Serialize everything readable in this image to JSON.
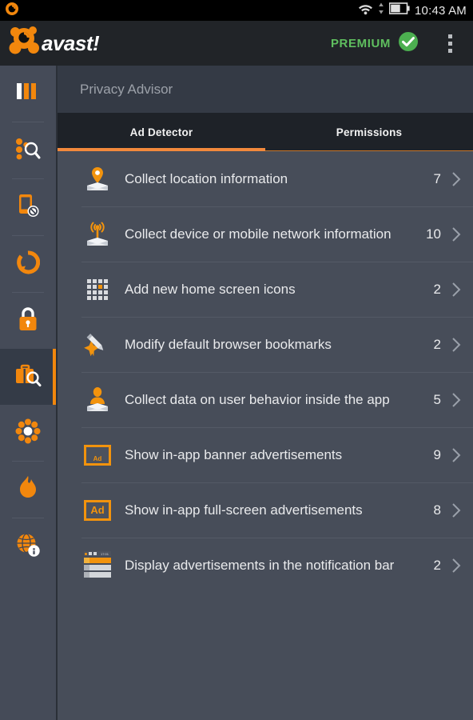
{
  "status_bar": {
    "time": "10:43 AM",
    "icons": [
      "avast-notification-icon",
      "wifi-icon",
      "data-transfer-icon",
      "battery-icon"
    ],
    "battery_level_percent": 60
  },
  "app_bar": {
    "brand": "avast!",
    "premium_label": "PREMIUM",
    "premium_checked": true,
    "overflow_label": "More options"
  },
  "sidebar": {
    "items": [
      {
        "name": "dashboard",
        "icon": "dashboard-bars-icon",
        "selected": false
      },
      {
        "name": "scan",
        "icon": "scan-magnifier-icon",
        "selected": false
      },
      {
        "name": "call-blocker",
        "icon": "phone-block-icon",
        "selected": false
      },
      {
        "name": "backup",
        "icon": "refresh-circle-icon",
        "selected": false
      },
      {
        "name": "app-locking",
        "icon": "padlock-icon",
        "selected": false
      },
      {
        "name": "privacy-advisor",
        "icon": "briefcase-magnifier-icon",
        "selected": true
      },
      {
        "name": "cleanup",
        "icon": "flower-cleanup-icon",
        "selected": false
      },
      {
        "name": "firewall",
        "icon": "flame-icon",
        "selected": false
      },
      {
        "name": "network-meter",
        "icon": "globe-info-icon",
        "selected": false
      }
    ]
  },
  "page": {
    "title": "Privacy Advisor"
  },
  "tabs": [
    {
      "label": "Ad Detector",
      "active": true
    },
    {
      "label": "Permissions",
      "active": false
    }
  ],
  "list": {
    "rows": [
      {
        "icon": "location-pin-envelope-icon",
        "label": "Collect location information",
        "count": "7"
      },
      {
        "icon": "signal-waves-envelope-icon",
        "label": "Collect device or mobile network information",
        "count": "10"
      },
      {
        "icon": "app-grid-icon",
        "label": "Add new home screen icons",
        "count": "2"
      },
      {
        "icon": "pencil-star-icon",
        "label": "Modify default browser bookmarks",
        "count": "2"
      },
      {
        "icon": "person-envelope-icon",
        "label": "Collect data on user behavior inside the app",
        "count": "5"
      },
      {
        "icon": "ad-banner-icon",
        "label": "Show in-app banner advertisements",
        "count": "9"
      },
      {
        "icon": "ad-fullscreen-icon",
        "label": "Show in-app full-screen advertisements",
        "count": "8"
      },
      {
        "icon": "notification-bar-ad-icon",
        "label": "Display advertisements in the notification bar",
        "count": "2"
      }
    ],
    "chevron_icon": "chevron-right-icon"
  },
  "colors": {
    "accent_orange": "#f2870d",
    "premium_green": "#5fbf5f",
    "content_bg": "#474d59",
    "sidebar_bg": "#454b58",
    "appbar_bg": "#212428",
    "tabbar_bg": "#1e2228",
    "title_bg": "#343a45"
  }
}
